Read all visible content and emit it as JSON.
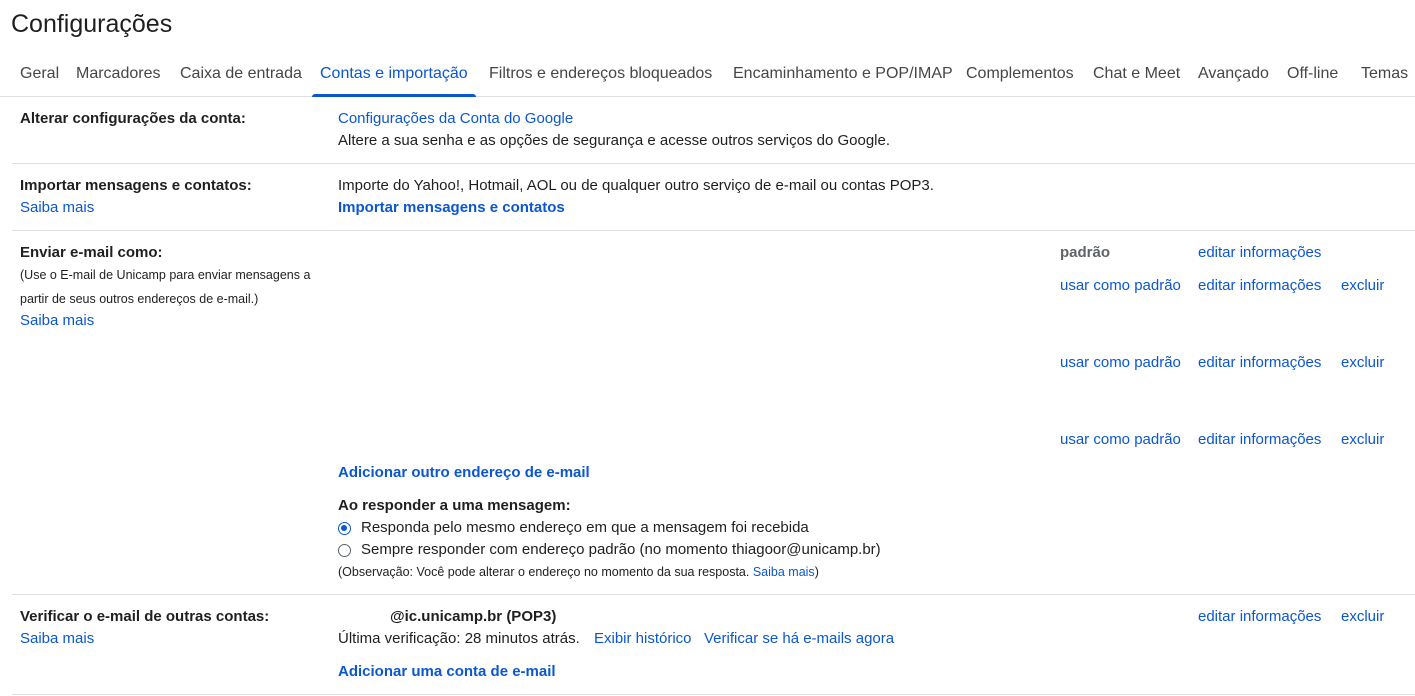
{
  "page_title": "Configurações",
  "tabs": [
    {
      "label": "Geral"
    },
    {
      "label": "Marcadores"
    },
    {
      "label": "Caixa de entrada"
    },
    {
      "label": "Contas e importação"
    },
    {
      "label": "Filtros e endereços bloqueados"
    },
    {
      "label": "Encaminhamento e POP/IMAP"
    },
    {
      "label": "Complementos"
    },
    {
      "label": "Chat e Meet"
    },
    {
      "label": "Avançado"
    },
    {
      "label": "Off-line"
    },
    {
      "label": "Temas"
    }
  ],
  "active_tab": "Contas e importação",
  "colors": {
    "accent": "#0b57d0",
    "text": "#1f1f1f",
    "divider": "#e0e0e0"
  },
  "account": {
    "label": "Alterar configurações da conta:",
    "link": "Configurações da Conta do Google",
    "description": "Altere a sua senha e as opções de segurança e acesse outros serviços do Google."
  },
  "import": {
    "label": "Importar mensagens e contatos:",
    "learn_more": "Saiba mais",
    "description": "Importe do Yahoo!, Hotmail, AOL ou de qualquer outro serviço de e-mail ou contas POP3.",
    "action": "Importar mensagens e contatos"
  },
  "send_as": {
    "label": "Enviar e-mail como:",
    "note_line1": "(Use o E-mail de Unicamp para enviar mensagens a",
    "note_line2": "partir de seus outros endereços de e-mail.)",
    "learn_more": "Saiba mais",
    "default_row": {
      "status": "padrão",
      "edit": "editar informações"
    },
    "rows": [
      {
        "make_default": "usar como padrão",
        "edit": "editar informações",
        "delete": "excluir"
      },
      {
        "make_default": "usar como padrão",
        "edit": "editar informações",
        "delete": "excluir"
      },
      {
        "make_default": "usar como padrão",
        "edit": "editar informações",
        "delete": "excluir"
      }
    ],
    "add_address": "Adicionar outro endereço de e-mail",
    "reply_heading": "Ao responder a uma mensagem:",
    "reply_options": [
      {
        "label": "Responda pelo mesmo endereço em que a mensagem foi recebida",
        "checked": true
      },
      {
        "label": "Sempre responder com endereço padrão (no momento thiagoor@unicamp.br)",
        "checked": false
      }
    ],
    "observation": "(Observação: Você pode alterar o endereço no momento da sua resposta.",
    "observation_link": "Saiba mais",
    "observation_end": ")"
  },
  "check_mail": {
    "label": "Verificar o e-mail de outras contas:",
    "learn_more": "Saiba mais",
    "account": "@ic.unicamp.br (POP3)",
    "last_check": "Última verificação: 28 minutos atrás.",
    "history": "Exibir histórico",
    "check_now": "Verificar se há e-mails agora",
    "edit": "editar informações",
    "delete": "excluir",
    "add_account": "Adicionar uma conta de e-mail"
  }
}
